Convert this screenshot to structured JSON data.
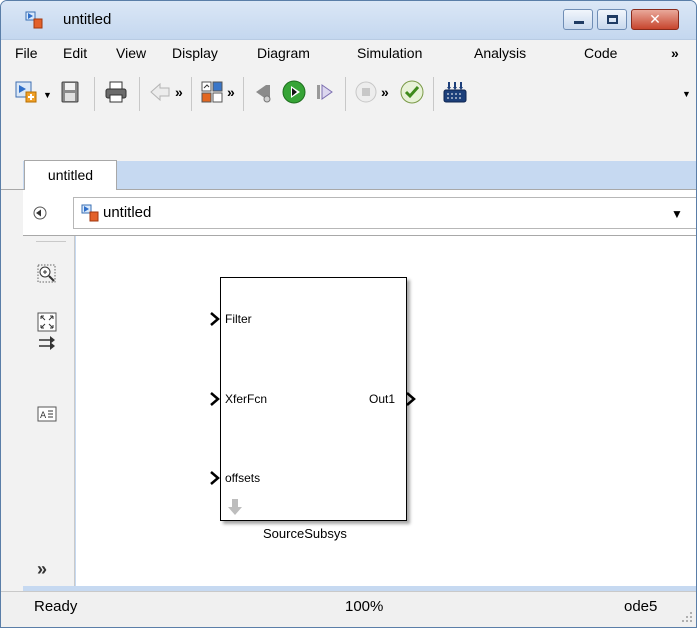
{
  "window": {
    "title": "untitled",
    "close_glyph": "✕"
  },
  "menubar": {
    "items": [
      "File",
      "Edit",
      "View",
      "Display",
      "Diagram",
      "Simulation",
      "Analysis",
      "Code"
    ],
    "overflow": "»"
  },
  "toolbar": {
    "overflow": "»",
    "dropdown": "▼",
    "icons": [
      "new-model-icon",
      "save-icon",
      "print-icon",
      "back-arrow-icon",
      "library-browser-icon",
      "step-back-icon",
      "run-icon",
      "step-forward-icon",
      "stop-icon",
      "model-advisor-check-icon",
      "build-icon"
    ]
  },
  "tabs": [
    {
      "label": "untitled"
    }
  ],
  "breadcrumb": {
    "label": "untitled",
    "dropdown": "▼"
  },
  "palette": {
    "icons": [
      "back-icon",
      "zoom-icon",
      "fit-to-view-icon",
      "arrow-icon",
      "annotation-icon"
    ],
    "expand": "»"
  },
  "block": {
    "name": "SourceSubsys",
    "inports": [
      "Filter",
      "XferFcn",
      "offsets"
    ],
    "outports": [
      "Out1"
    ]
  },
  "statusbar": {
    "status": "Ready",
    "zoom": "100%",
    "solver": "ode5"
  },
  "colors": {
    "title_bar": "#c4d7ef",
    "close_button": "#c7452d",
    "run_button": "#36a436"
  }
}
